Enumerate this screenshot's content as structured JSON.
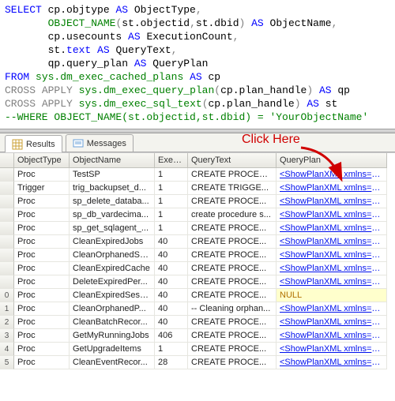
{
  "sql": {
    "tokens": [
      {
        "t": "SELECT",
        "c": "kw"
      },
      {
        "t": " cp.objtype "
      },
      {
        "t": "AS",
        "c": "kw"
      },
      {
        "t": " ObjectType"
      },
      {
        "t": ",",
        "c": "gray"
      },
      {
        "t": "\n"
      },
      {
        "t": "       "
      },
      {
        "t": "OBJECT_NAME",
        "c": "fn"
      },
      {
        "t": "(",
        "c": "gray"
      },
      {
        "t": "st.objectid"
      },
      {
        "t": ",",
        "c": "gray"
      },
      {
        "t": "st.dbid"
      },
      {
        "t": ")",
        "c": "gray"
      },
      {
        "t": " "
      },
      {
        "t": "AS",
        "c": "kw"
      },
      {
        "t": " ObjectName"
      },
      {
        "t": ",",
        "c": "gray"
      },
      {
        "t": "\n"
      },
      {
        "t": "       cp.usecounts "
      },
      {
        "t": "AS",
        "c": "kw"
      },
      {
        "t": " ExecutionCount"
      },
      {
        "t": ",",
        "c": "gray"
      },
      {
        "t": "\n"
      },
      {
        "t": "       st."
      },
      {
        "t": "text",
        "c": "kw"
      },
      {
        "t": " "
      },
      {
        "t": "AS",
        "c": "kw"
      },
      {
        "t": " QueryText"
      },
      {
        "t": ",",
        "c": "gray"
      },
      {
        "t": "\n"
      },
      {
        "t": "       qp.query_plan "
      },
      {
        "t": "AS",
        "c": "kw"
      },
      {
        "t": " QueryPlan\n"
      },
      {
        "t": "FROM",
        "c": "kw"
      },
      {
        "t": " "
      },
      {
        "t": "sys.dm_exec_cached_plans",
        "c": "sys"
      },
      {
        "t": " "
      },
      {
        "t": "AS",
        "c": "kw"
      },
      {
        "t": " cp\n"
      },
      {
        "t": "CROSS",
        "c": "gray"
      },
      {
        "t": " "
      },
      {
        "t": "APPLY",
        "c": "gray"
      },
      {
        "t": " "
      },
      {
        "t": "sys.dm_exec_query_plan",
        "c": "sys"
      },
      {
        "t": "(",
        "c": "gray"
      },
      {
        "t": "cp.plan_handle"
      },
      {
        "t": ")",
        "c": "gray"
      },
      {
        "t": " "
      },
      {
        "t": "AS",
        "c": "kw"
      },
      {
        "t": " qp\n"
      },
      {
        "t": "CROSS",
        "c": "gray"
      },
      {
        "t": " "
      },
      {
        "t": "APPLY",
        "c": "gray"
      },
      {
        "t": " "
      },
      {
        "t": "sys.dm_exec_sql_text",
        "c": "sys"
      },
      {
        "t": "(",
        "c": "gray"
      },
      {
        "t": "cp.plan_handle"
      },
      {
        "t": ")",
        "c": "gray"
      },
      {
        "t": " "
      },
      {
        "t": "AS",
        "c": "kw"
      },
      {
        "t": " st\n"
      },
      {
        "t": "--WHERE OBJECT_NAME(st.objectid,st.dbid) = 'YourObjectName'",
        "c": "cmnt"
      }
    ]
  },
  "tabs": {
    "results": "Results",
    "messages": "Messages"
  },
  "annotation": "Click Here",
  "grid": {
    "headers": [
      "",
      "ObjectType",
      "ObjectName",
      "Exec...",
      "QueryText",
      "QueryPlan"
    ],
    "rows": [
      {
        "n": "",
        "type": "Proc",
        "name": "TestSP",
        "exec": "1",
        "query": "CREATE PROCED...",
        "plan": "<ShowPlanXML xmlns=\"http"
      },
      {
        "n": "",
        "type": "Trigger",
        "name": "trig_backupset_d...",
        "exec": "1",
        "query": "CREATE TRIGGE...",
        "plan": "<ShowPlanXML xmlns=\"http"
      },
      {
        "n": "",
        "type": "Proc",
        "name": "sp_delete_databa...",
        "exec": "1",
        "query": "CREATE  PROCE...",
        "plan": "<ShowPlanXML xmlns=\"http"
      },
      {
        "n": "",
        "type": "Proc",
        "name": "sp_db_vardecima...",
        "exec": "1",
        "query": "create procedure s...",
        "plan": "<ShowPlanXML xmlns=\"http"
      },
      {
        "n": "",
        "type": "Proc",
        "name": "sp_get_sqlagent_...",
        "exec": "1",
        "query": "CREATE PROCE...",
        "plan": "<ShowPlanXML xmlns=\"http"
      },
      {
        "n": "",
        "type": "Proc",
        "name": "CleanExpiredJobs",
        "exec": "40",
        "query": "CREATE PROCE...",
        "plan": "<ShowPlanXML xmlns=\"http"
      },
      {
        "n": "",
        "type": "Proc",
        "name": "CleanOrphanedSo...",
        "exec": "40",
        "query": "CREATE PROCE...",
        "plan": "<ShowPlanXML xmlns=\"http"
      },
      {
        "n": "",
        "type": "Proc",
        "name": "CleanExpiredCache",
        "exec": "40",
        "query": "CREATE PROCE...",
        "plan": "<ShowPlanXML xmlns=\"http"
      },
      {
        "n": "",
        "type": "Proc",
        "name": "DeleteExpiredPer...",
        "exec": "40",
        "query": "CREATE PROCE...",
        "plan": "<ShowPlanXML xmlns=\"http"
      },
      {
        "n": "0",
        "type": "Proc",
        "name": "CleanExpiredSess...",
        "exec": "40",
        "query": "CREATE PROCE...",
        "plan": "NULL",
        "null": true
      },
      {
        "n": "1",
        "type": "Proc",
        "name": "CleanOrphanedP...",
        "exec": "40",
        "query": "-- Cleaning orphan...",
        "plan": "<ShowPlanXML xmlns=\"http"
      },
      {
        "n": "2",
        "type": "Proc",
        "name": "CleanBatchRecor...",
        "exec": "40",
        "query": "CREATE PROCE...",
        "plan": "<ShowPlanXML xmlns=\"http"
      },
      {
        "n": "3",
        "type": "Proc",
        "name": "GetMyRunningJobs",
        "exec": "406",
        "query": "CREATE PROCE...",
        "plan": "<ShowPlanXML xmlns=\"http"
      },
      {
        "n": "4",
        "type": "Proc",
        "name": "GetUpgradeItems",
        "exec": "1",
        "query": "CREATE PROCE...",
        "plan": "<ShowPlanXML xmlns=\"http"
      },
      {
        "n": "5",
        "type": "Proc",
        "name": "CleanEventRecor...",
        "exec": "28",
        "query": "CREATE PROCE...",
        "plan": "<ShowPlanXML xmlns=\"http"
      }
    ]
  }
}
